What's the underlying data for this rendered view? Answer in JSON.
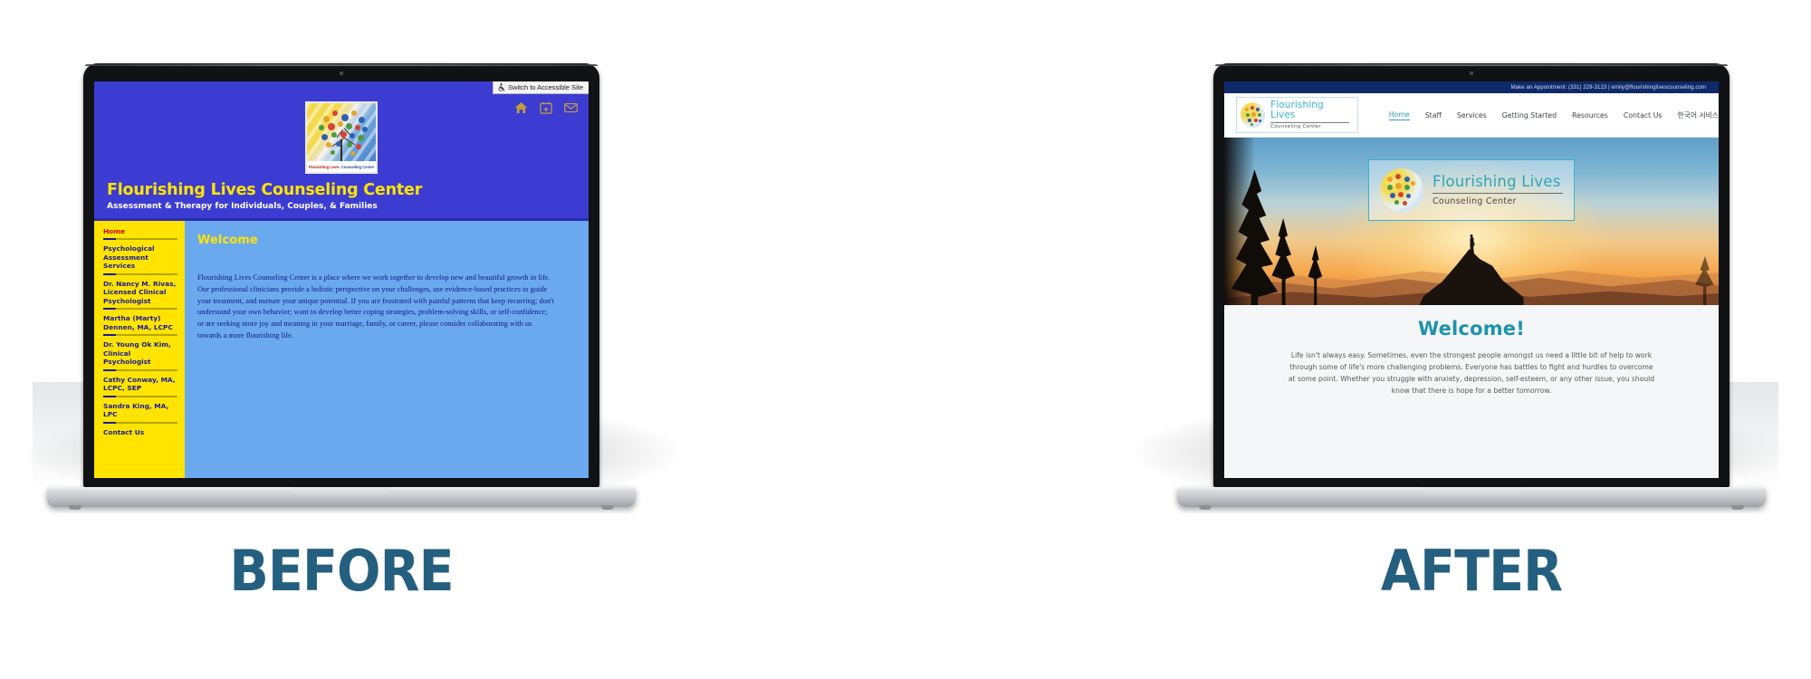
{
  "captions": {
    "before": "BEFORE",
    "after": "AFTER",
    "color": "#245f7f"
  },
  "before_site": {
    "accessible_button": "Switch to Accessible Site",
    "accessible_icon": "wheelchair-icon",
    "header_icons": [
      "home-icon",
      "calendar-icon",
      "envelope-icon"
    ],
    "logo": {
      "caption_left": "Flourishing Lives",
      "caption_right": "Counseling Center",
      "alt": "tree-logo"
    },
    "title": "Flourishing Lives Counseling Center",
    "subtitle": "Assessment & Therapy for Individuals, Couples, & Families",
    "nav": [
      {
        "label": "Home",
        "active": true
      },
      {
        "label": "Psychological Assessment Services",
        "active": false
      },
      {
        "label": "Dr. Nancy M. Rivas, Licensed Clinical Psychologist",
        "active": false
      },
      {
        "label": "Martha (Marty) Dennen, MA, LCPC",
        "active": false
      },
      {
        "label": "Dr. Young Ok Kim, Clinical Psychologist",
        "active": false
      },
      {
        "label": "Cathy Conway, MA, LCPC, SEP",
        "active": false
      },
      {
        "label": "Sandra King, MA, LPC",
        "active": false
      },
      {
        "label": "Contact Us",
        "active": false
      }
    ],
    "content_heading": "Welcome",
    "content_paragraph": "Flourishing Lives Counseling Center is a place where we work together to develop new and beautiful growth in life. Our professional clinicians provide a holistic perspective on your challenges, use evidence-based practices to guide your treatment, and nurture your unique potential. If you are frustrated with painful patterns that keep recurring; don't understand your own behavior; want to develop better coping strategies, problem-solving skills, or self-confidence; or are seeking more joy and meaning in your marriage, family, or career, please consider collaborating with us towards a more flourishing life.",
    "colors": {
      "header_bg": "#3c3cd2",
      "nav_bg": "#ffe400",
      "content_bg": "#6aa9ee",
      "title_color": "#ffe400",
      "nav_link": "#1a1a9c",
      "nav_active": "#cc0000"
    }
  },
  "after_site": {
    "topbar": "Make an Appointment: (331) 229-3123 | emily@flourishinglivescounseling.com",
    "brand": {
      "line1": "Flourishing Lives",
      "line2": "Counseling Center",
      "mark": "tree-logo"
    },
    "menu": [
      {
        "label": "Home",
        "active": true
      },
      {
        "label": "Staff",
        "active": false
      },
      {
        "label": "Services",
        "active": false
      },
      {
        "label": "Getting Started",
        "active": false
      },
      {
        "label": "Resources",
        "active": false
      },
      {
        "label": "Contact Us",
        "active": false
      },
      {
        "label": "한국어 서비스",
        "active": false
      }
    ],
    "hero": {
      "line1": "Flourishing Lives",
      "line2": "Counseling Center",
      "image_alt": "sunset-mountain-hiker-photo"
    },
    "welcome_heading": "Welcome!",
    "welcome_paragraph": "Life isn't always easy. Sometimes, even the strongest people amongst us need a little bit of help to work through some of life's more challenging problems. Everyone has battles to fight and hurdles to overcome at some point. Whether you struggle with anxiety, depression, self-esteem, or any other issue, you should know that there is hope for a better tomorrow.",
    "colors": {
      "topbar_bg": "#0e2a6b",
      "accent_teal": "#2aa6bd",
      "section_bg": "#f5f6f7"
    }
  }
}
